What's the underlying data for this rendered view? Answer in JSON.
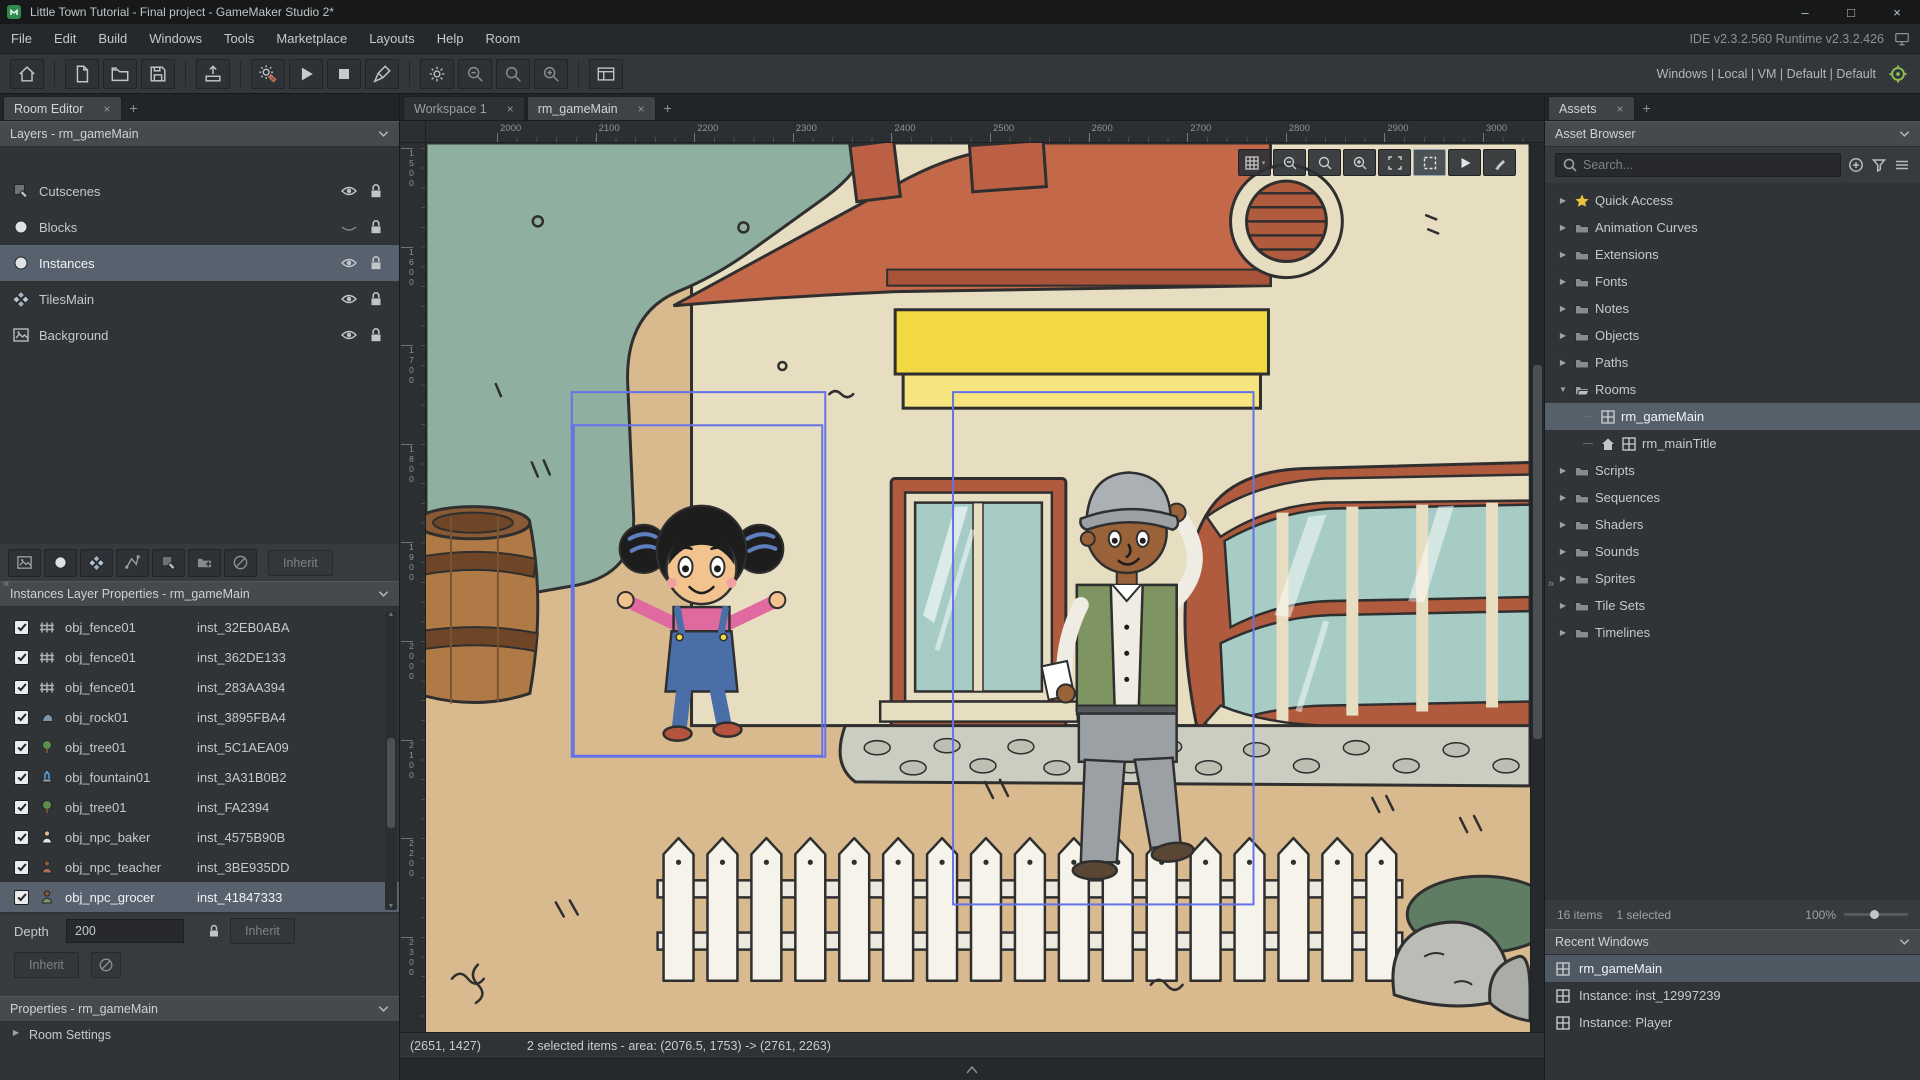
{
  "window": {
    "title": "Little Town Tutorial - Final project - GameMaker Studio 2*",
    "version": "IDE v2.3.2.560 Runtime v2.3.2.426"
  },
  "menu": {
    "items": [
      "File",
      "Edit",
      "Build",
      "Windows",
      "Tools",
      "Marketplace",
      "Layouts",
      "Help",
      "Room"
    ]
  },
  "toolbar": {
    "targets": "Windows | Local | VM | Default | Default"
  },
  "left_panel": {
    "tab": "Room Editor",
    "layers_header": "Layers - rm_gameMain",
    "layers": [
      {
        "name": "Cutscenes",
        "icon": "asset-layer"
      },
      {
        "name": "Blocks",
        "icon": "instance-layer",
        "eye_off": true
      },
      {
        "name": "Instances",
        "icon": "instance-layer",
        "selected": true
      },
      {
        "name": "TilesMain",
        "icon": "tile-layer"
      },
      {
        "name": "Background",
        "icon": "background-layer"
      }
    ],
    "layer_tools_inherit": "Inherit",
    "instances_header": "Instances Layer Properties - rm_gameMain",
    "instances": [
      {
        "obj": "obj_fence01",
        "inst": "inst_32EB0ABA",
        "icon": "fence"
      },
      {
        "obj": "obj_fence01",
        "inst": "inst_362DE133",
        "icon": "fence"
      },
      {
        "obj": "obj_fence01",
        "inst": "inst_283AA394",
        "icon": "fence"
      },
      {
        "obj": "obj_rock01",
        "inst": "inst_3895FBA4",
        "icon": "rock"
      },
      {
        "obj": "obj_tree01",
        "inst": "inst_5C1AEA09",
        "icon": "tree"
      },
      {
        "obj": "obj_fountain01",
        "inst": "inst_3A31B0B2",
        "icon": "fountain"
      },
      {
        "obj": "obj_tree01",
        "inst": "inst_FA2394",
        "icon": "tree"
      },
      {
        "obj": "obj_npc_baker",
        "inst": "inst_4575B90B",
        "icon": "npc-baker"
      },
      {
        "obj": "obj_npc_teacher",
        "inst": "inst_3BE935DD",
        "icon": "npc-teacher"
      },
      {
        "obj": "obj_npc_grocer",
        "inst": "inst_41847333",
        "icon": "npc-grocer",
        "selected": true
      }
    ],
    "depth": {
      "label": "Depth",
      "value": "200",
      "inherit": "Inherit"
    },
    "inherit_button": "Inherit",
    "properties_header": "Properties - rm_gameMain",
    "room_settings": "Room Settings"
  },
  "center": {
    "tabs": [
      {
        "label": "Workspace 1"
      },
      {
        "label": "rm_gameMain",
        "active": true
      }
    ],
    "ruler_h": [
      "2000",
      "2100",
      "2200",
      "2300",
      "2400",
      "2500",
      "2600",
      "2700",
      "2800",
      "2900",
      "3000"
    ],
    "ruler_v": [
      "1500",
      "1600",
      "1700",
      "1800",
      "1900",
      "2000",
      "2100",
      "2200",
      "2300"
    ],
    "status": {
      "coords": "(2651, 1427)",
      "selection": "2 selected items - area: (2076.5, 1753) -> (2761, 2263)"
    }
  },
  "right_panel": {
    "tab": "Assets",
    "browser_header": "Asset Browser",
    "search_placeholder": "Search...",
    "tree": [
      {
        "label": "Quick Access",
        "icon": "star",
        "arrow": "right"
      },
      {
        "label": "Animation Curves",
        "icon": "folder",
        "arrow": "right"
      },
      {
        "label": "Extensions",
        "icon": "folder",
        "arrow": "right"
      },
      {
        "label": "Fonts",
        "icon": "folder",
        "arrow": "right"
      },
      {
        "label": "Notes",
        "icon": "folder",
        "arrow": "right"
      },
      {
        "label": "Objects",
        "icon": "folder",
        "arrow": "right"
      },
      {
        "label": "Paths",
        "icon": "folder",
        "arrow": "right"
      },
      {
        "label": "Rooms",
        "icon": "folder-open",
        "arrow": "down"
      },
      {
        "label": "rm_gameMain",
        "icon": "room",
        "child": true,
        "selected": true
      },
      {
        "label": "rm_mainTitle",
        "icon": "room",
        "child": true,
        "home": true
      },
      {
        "label": "Scripts",
        "icon": "folder",
        "arrow": "right"
      },
      {
        "label": "Sequences",
        "icon": "folder",
        "arrow": "right"
      },
      {
        "label": "Shaders",
        "icon": "folder",
        "arrow": "right"
      },
      {
        "label": "Sounds",
        "icon": "folder",
        "arrow": "right"
      },
      {
        "label": "Sprites",
        "icon": "folder",
        "arrow": "right"
      },
      {
        "label": "Tile Sets",
        "icon": "folder",
        "arrow": "right"
      },
      {
        "label": "Timelines",
        "icon": "folder",
        "arrow": "right"
      }
    ],
    "footer": {
      "items": "16 items",
      "selected": "1 selected",
      "zoom": "100%"
    },
    "recent_header": "Recent Windows",
    "recent": [
      {
        "label": "rm_gameMain",
        "selected": true
      },
      {
        "label": "Instance: inst_12997239"
      },
      {
        "label": "Instance: Player"
      }
    ]
  }
}
